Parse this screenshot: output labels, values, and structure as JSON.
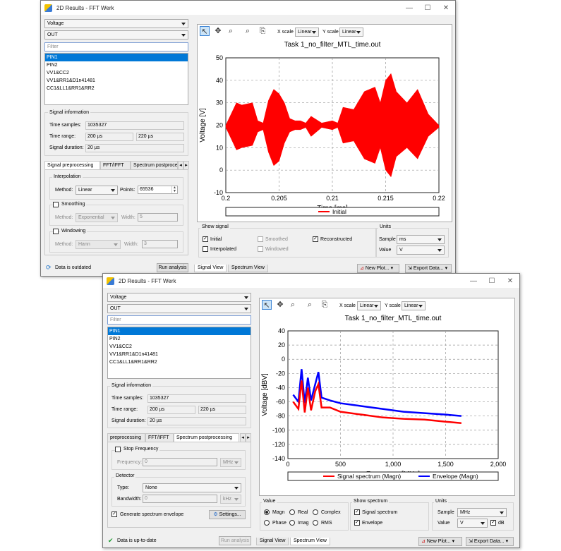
{
  "window1": {
    "title": "2D Results - FFT Werk",
    "quantity": "Voltage",
    "port": "OUT",
    "filter_placeholder": "Filter",
    "signals": [
      "PIN1",
      "PIN2",
      "VV1&CC2",
      "VV1&RR1&D1n41481",
      "CC1&LL1&RR1&RR2"
    ],
    "selected_signal": "PIN1",
    "signal_info": {
      "title": "Signal information",
      "time_samples_label": "Time samples:",
      "time_samples": "1035327",
      "time_range_label": "Time range:",
      "time_range_from": "200 µs",
      "time_range_to": "220 µs",
      "duration_label": "Signal duration:",
      "duration": "20 µs"
    },
    "tabs": [
      "Signal preprocessing",
      "FFT/IFFT",
      "Spectrum postproces"
    ],
    "interpolation": {
      "title": "Interpolation",
      "method_label": "Method:",
      "method": "Linear",
      "points_label": "Points:",
      "points": "65536"
    },
    "smoothing": {
      "title": "Smoothing",
      "method_label": "Method:",
      "method": "Exponential",
      "width_label": "Width:",
      "width": "5"
    },
    "windowing": {
      "title": "Windowing",
      "method_label": "Method:",
      "method": "Hann",
      "width_label": "Width:",
      "width": "3"
    },
    "status": "Data is outdated",
    "run_button": "Run analysis",
    "toolbar": {
      "xscale_label": "X scale",
      "xscale": "Linear",
      "yscale_label": "Y scale",
      "yscale": "Linear"
    },
    "show_signal": {
      "title": "Show signal",
      "initial": "Initial",
      "interpolated": "Interpolated",
      "smoothed": "Smoothed",
      "windowed": "Windowed",
      "reconstructed": "Reconstructed"
    },
    "units": {
      "title": "Units",
      "sample_label": "Sample",
      "sample": "ms",
      "value_label": "Value",
      "value": "V"
    },
    "bottom_tabs": [
      "Signal View",
      "Spectrum View"
    ],
    "new_plot": "New Plot...",
    "export": "Export Data...",
    "chart_data": {
      "type": "line",
      "title": "Task 1_no_filter_MTL_time.out",
      "xlabel": "Time [ms]",
      "ylabel": "Voltage [V]",
      "xlim": [
        0.2,
        0.22
      ],
      "ylim": [
        -10,
        50
      ],
      "xticks": [
        "0.2",
        "0.205",
        "0.21",
        "0.215",
        "0.22"
      ],
      "yticks": [
        "-10",
        "0",
        "10",
        "20",
        "30",
        "40",
        "50"
      ],
      "grid": true,
      "legend": "bottom",
      "series": [
        {
          "name": "Initial",
          "color": "#ff0000",
          "x": [
            0.2,
            0.201,
            0.2015,
            0.2025,
            0.203,
            0.2035,
            0.204,
            0.2045,
            0.205,
            0.2055,
            0.206,
            0.2065,
            0.207,
            0.2075,
            0.208,
            0.209,
            0.21,
            0.2105,
            0.211,
            0.212,
            0.213,
            0.214,
            0.2145,
            0.215,
            0.2155,
            0.216,
            0.217,
            0.218,
            0.219,
            0.22
          ],
          "max": [
            20,
            30,
            29,
            30,
            22,
            21,
            31,
            36,
            34,
            30,
            23,
            22,
            22,
            21,
            24,
            21,
            22,
            21,
            28,
            27,
            35,
            37,
            30,
            40,
            43,
            35,
            30,
            36,
            25,
            20
          ],
          "min": [
            19,
            9,
            10,
            11,
            17,
            18,
            8,
            2,
            4,
            12,
            17,
            18,
            18,
            19,
            15,
            19,
            18,
            19,
            12,
            13,
            5,
            3,
            10,
            0,
            -3,
            6,
            10,
            5,
            15,
            19
          ]
        }
      ]
    }
  },
  "window2": {
    "title": "2D Results - FFT Werk",
    "quantity": "Voltage",
    "port": "OUT",
    "filter_placeholder": "Filter",
    "signals": [
      "PIN1",
      "PIN2",
      "VV1&CC2",
      "VV1&RR1&D1n41481",
      "CC1&LL1&RR1&RR2"
    ],
    "selected_signal": "PIN1",
    "signal_info": {
      "title": "Signal information",
      "time_samples_label": "Time samples:",
      "time_samples": "1035327",
      "time_range_label": "Time range:",
      "time_range_from": "200 µs",
      "time_range_to": "220 µs",
      "duration_label": "Signal duration:",
      "duration": "20 µs"
    },
    "tabs": [
      "preprocessing",
      "FFT/IFFT",
      "Spectrum postprocessing"
    ],
    "stop_frequency": {
      "title": "Stop Frequency",
      "frequency_label": "Frequency:",
      "frequency": "0",
      "unit": "MHz"
    },
    "detector": {
      "title": "Detector",
      "type_label": "Type:",
      "type": "None",
      "bandwidth_label": "Bandwidth:",
      "bandwidth": "0",
      "unit": "kHz"
    },
    "envelope_label": "Generate spectrum envelope",
    "settings_button": "Settings...",
    "status": "Data is up-to-date",
    "run_button": "Run analysis",
    "toolbar": {
      "xscale_label": "X scale",
      "xscale": "Linear",
      "yscale_label": "Y scale",
      "yscale": "Linear"
    },
    "value_group": {
      "title": "Value",
      "magn": "Magn",
      "real": "Real",
      "complex": "Complex",
      "phase": "Phase",
      "imag": "Imag",
      "rms": "RMS"
    },
    "show_spectrum": {
      "title": "Show spectrum",
      "signal_spectrum": "Signal spectrum",
      "envelope": "Envelope"
    },
    "units": {
      "title": "Units",
      "sample_label": "Sample",
      "sample": "MHz",
      "value_label": "Value",
      "value": "V",
      "db_label": "dB"
    },
    "bottom_tabs": [
      "Signal View",
      "Spectrum View"
    ],
    "new_plot": "New Plot...",
    "export": "Export Data...",
    "chart_data": {
      "type": "line",
      "title": "Task 1_no_filter_MTL_time.out",
      "xlabel": "Frequency [MHz]",
      "ylabel": "Voltage [dBV]",
      "xlim": [
        0,
        2000
      ],
      "ylim": [
        -140,
        40
      ],
      "xticks": [
        "0",
        "500",
        "1,000",
        "1,500",
        "2,000"
      ],
      "yticks": [
        "-140",
        "-120",
        "-100",
        "-80",
        "-60",
        "-40",
        "-20",
        "0",
        "20",
        "40"
      ],
      "grid": true,
      "legend": "bottom",
      "series": [
        {
          "name": "Signal spectrum (Magn)",
          "color": "#ff0000",
          "x": [
            50,
            100,
            130,
            160,
            190,
            220,
            260,
            290,
            320,
            400,
            500,
            700,
            900,
            1100,
            1300,
            1500,
            1650
          ],
          "y": [
            -60,
            -70,
            -30,
            -75,
            -40,
            -72,
            -45,
            -35,
            -68,
            -68,
            -74,
            -78,
            -82,
            -84,
            -85,
            -88,
            -90
          ]
        },
        {
          "name": "Envelope (Magn)",
          "color": "#0000ff",
          "x": [
            50,
            100,
            130,
            160,
            190,
            220,
            260,
            290,
            320,
            400,
            500,
            700,
            900,
            1100,
            1300,
            1500,
            1650
          ],
          "y": [
            -50,
            -60,
            -14,
            -62,
            -26,
            -58,
            -35,
            -18,
            -54,
            -58,
            -62,
            -66,
            -70,
            -74,
            -76,
            -78,
            -80
          ]
        }
      ]
    }
  }
}
